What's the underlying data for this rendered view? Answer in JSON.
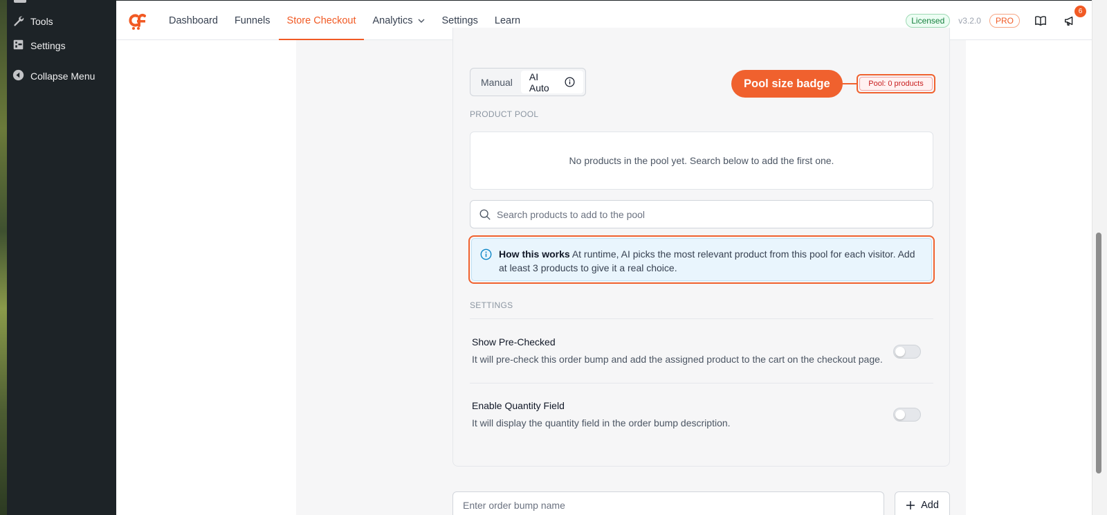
{
  "wp_sidebar": {
    "items": [
      {
        "label": "Tools",
        "icon": "wrench-icon"
      },
      {
        "label": "Settings",
        "icon": "settings-grid-icon"
      },
      {
        "label": "Collapse Menu",
        "icon": "collapse-arrow-icon"
      }
    ]
  },
  "topbar": {
    "nav": [
      {
        "label": "Dashboard"
      },
      {
        "label": "Funnels"
      },
      {
        "label": "Store Checkout",
        "active": true
      },
      {
        "label": "Analytics",
        "has_dropdown": true
      },
      {
        "label": "Settings"
      },
      {
        "label": "Learn"
      }
    ],
    "licensed": "Licensed",
    "version": "v3.2.0",
    "pro": "PRO",
    "notification_count": "6",
    "accent": "#f15a24"
  },
  "card": {
    "mode_toggle": {
      "manual": "Manual",
      "ai_auto": "AI Auto",
      "selected": "AI Auto"
    },
    "callout": "Pool size badge",
    "pool_badge": "Pool: 0 products",
    "product_pool_label": "PRODUCT POOL",
    "empty_pool_text": "No products in the pool yet. Search below to add the first one.",
    "search_placeholder": "Search products to add to the pool",
    "how_it_works": {
      "title": "How this works",
      "text": "At runtime, AI picks the most relevant product from this pool for each visitor. Add at least 3 products to give it a real choice."
    },
    "settings_label": "SETTINGS",
    "settings": [
      {
        "title": "Show Pre-Checked",
        "desc": "It will pre-check this order bump and add the assigned product to the cart on the checkout page.",
        "enabled": false
      },
      {
        "title": "Enable Quantity Field",
        "desc": "It will display the quantity field in the order bump description.",
        "enabled": false
      }
    ]
  },
  "footer_form": {
    "name_placeholder": "Enter order bump name",
    "add_label": "Add"
  }
}
